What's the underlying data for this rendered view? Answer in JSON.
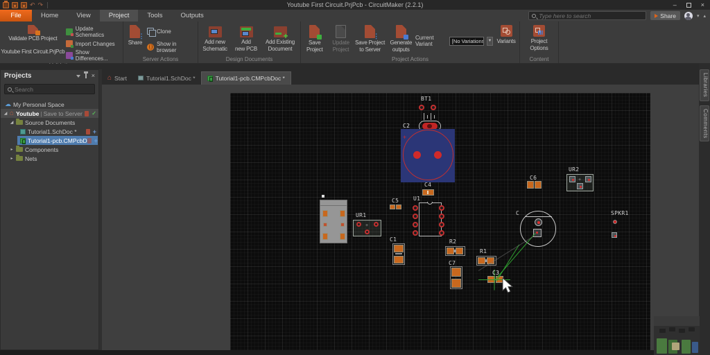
{
  "window": {
    "title": "Youtube First Circuit.PrjPcb - CircuitMaker (2.2.1)"
  },
  "menu": {
    "file": "File",
    "home": "Home",
    "view": "View",
    "project": "Project",
    "tools": "Tools",
    "outputs": "Outputs"
  },
  "topbar": {
    "search_placeholder": "Type here to search",
    "share": "Share"
  },
  "ribbon": {
    "validation": {
      "validate_line1": "Validate PCB Project",
      "validate_line2": "Youtube First Circuit.PrjPcb",
      "update_schematics": "Update Schematics",
      "import_changes": "Import Changes",
      "show_differences": "Show Differences...",
      "group": "Validation"
    },
    "server_actions": {
      "share": "Share",
      "clone": "Clone",
      "show_in_browser": "Show in browser",
      "group": "Server Actions"
    },
    "design_documents": {
      "add_new_schematic": "Add new\nSchematic",
      "add_new_pcb": "Add\nnew PCB",
      "add_existing": "Add Existing\nDocument",
      "group": "Design Documents"
    },
    "project_actions": {
      "save_project": "Save\nProject",
      "update_project": "Update\nProject",
      "save_to_server": "Save Project\nto Server",
      "generate_outputs": "Generate\noutputs",
      "current_variant": "Current Variant",
      "variant_value": "[No Variations]",
      "variants": "Variants",
      "group": "Project Actions"
    },
    "content": {
      "project_options": "Project\nOptions",
      "group": "Content"
    }
  },
  "projects_panel": {
    "title": "Projects",
    "search_placeholder": "Search",
    "tree": {
      "personal_space": "My Personal Space",
      "project_name": "Youtube",
      "project_status": "Save to Server",
      "source_documents": "Source Documents",
      "schdoc": "Tutorial1.SchDoc *",
      "pcbdoc": "Tutorial1-pcb.CMPcbD",
      "components": "Components",
      "nets": "Nets"
    }
  },
  "doc_tabs": {
    "start": "Start",
    "schdoc": "Tutorial1.SchDoc *",
    "pcbdoc": "Tutorial1-pcb.CMPcbDoc *"
  },
  "right_tabs": {
    "libraries": "Libraries",
    "comments": "Comments"
  },
  "pcb": {
    "refs": {
      "bt1": "BT1",
      "c2": "C2",
      "c4": "C4",
      "c5": "C5",
      "u1": "U1",
      "ur1": "UR1",
      "c6": "C6",
      "ur2": "UR2",
      "c": "C",
      "spkr1": "SPKR1",
      "c1": "C1",
      "r2": "R2",
      "r1": "R1",
      "c7": "C7",
      "c3": "C3"
    }
  },
  "colors": {
    "accent_orange": "#d95c12",
    "pad_orange": "#c8681e",
    "pad_red": "#d02a2a",
    "ratsnest_green": "#2f9e2f",
    "selection_blue": "#4f7cae",
    "component_selection_blue": "#2b3677"
  }
}
